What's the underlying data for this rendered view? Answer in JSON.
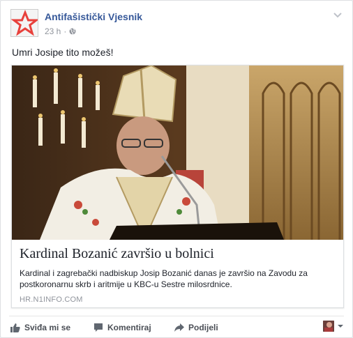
{
  "post": {
    "page_name": "Antifašistički Vjesnik",
    "time": "23 h",
    "meta_separator": "·",
    "text": "Umri Josipe tito možeš!"
  },
  "link": {
    "title": "Kardinal Bozanić završio u bolnici",
    "description": "Kardinal i zagrebački nadbiskup Josip Bozanić danas je završio na Zavodu za postkoronarnu skrb i aritmije u KBC-u Sestre milosrdnice.",
    "domain": "HR.N1INFO.COM"
  },
  "actions": {
    "like": "Sviđa mi se",
    "comment": "Komentiraj",
    "share": "Podijeli"
  },
  "icons": {
    "avatar": "red-star-logo-icon",
    "privacy": "globe-icon",
    "options": "chevron-down-icon",
    "like": "thumbs-up-icon",
    "comment": "comment-icon",
    "share": "share-arrow-icon",
    "reaction": "chevron-down-icon"
  },
  "colors": {
    "link_blue": "#365899",
    "meta_gray": "#90949c",
    "action_gray": "#4b4f56",
    "star_red": "#e8413c"
  }
}
